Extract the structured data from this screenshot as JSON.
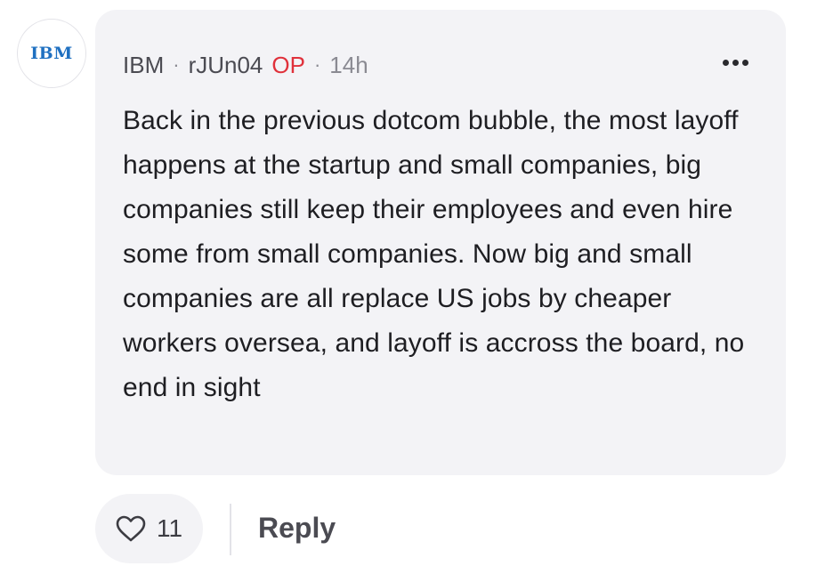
{
  "comment": {
    "avatar_logo_text": "IBM",
    "company": "IBM",
    "username": "rJUn04",
    "op_badge": "OP",
    "time": "14h",
    "separator": "·",
    "body": "Back in the previous dotcom bubble, the most layoff happens at the startup and small companies, big companies still keep their employees and even hire some from small companies. Now big and small companies are all replace US jobs by cheaper workers oversea, and layoff is accross the board, no end in sight",
    "more_icon": "more-horizontal-icon"
  },
  "actions": {
    "like_icon": "heart-icon",
    "like_count": "11",
    "reply_label": "Reply"
  },
  "colors": {
    "bubble_bg": "#f3f3f6",
    "op_badge": "#e0313b",
    "ibm_blue": "#1f70c1",
    "text": "#1e1e22",
    "muted": "#8a8a92"
  }
}
